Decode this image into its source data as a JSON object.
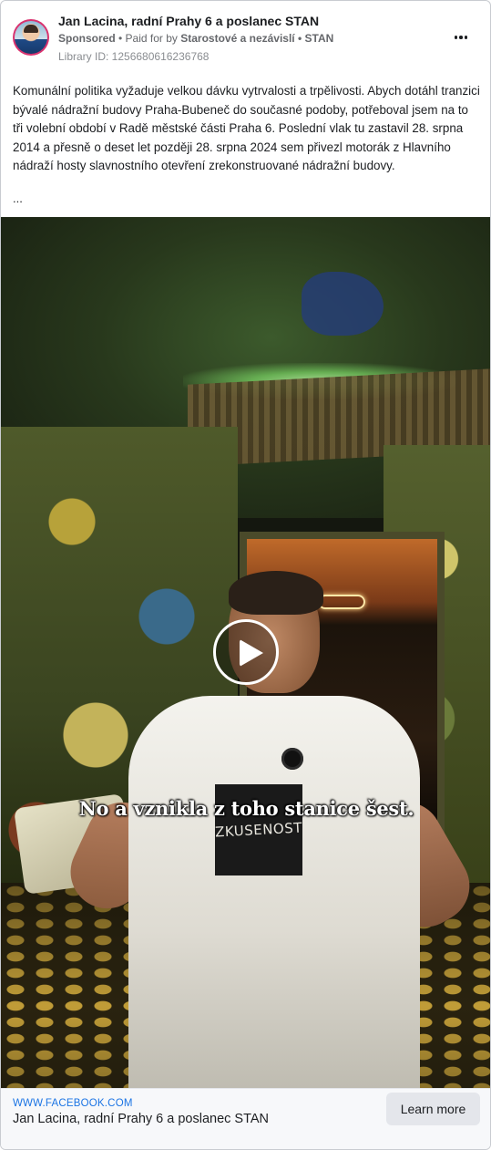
{
  "header": {
    "page_name": "Jan Lacina, radní Prahy 6 a poslanec STAN",
    "sponsored_label": "Sponsored",
    "separator": " • ",
    "paid_for_prefix": "Paid for by ",
    "payer": "Starostové a nezávislí • STAN",
    "library_id": "Library ID: 1256680616236768",
    "more_icon": "more-horizontal-icon"
  },
  "body": {
    "text": "Komunální politika vyžaduje velkou dávku vytrvalosti a trpělivosti. Abych dotáhl tranzici bývalé nádražní budovy Praha-Bubeneč do současné podoby, potřeboval jsem na to tři volební období v Radě městské části Praha 6. Poslední vlak tu zastavil 28. srpna 2014 a přesně o deset let později 28. srpna 2024 sem přivezl motorák z Hlavního nádraží hosty slavnostního otevření zrekonstruované nádražní budovy.",
    "ellipsis": "..."
  },
  "video": {
    "subtitle": "No a vznikla z toho stanice šest.",
    "shirt_text": "ZKUSENOST",
    "play_icon": "play-icon"
  },
  "footer": {
    "domain": "WWW.FACEBOOK.COM",
    "title": "Jan Lacina, radní Prahy 6 a poslanec STAN",
    "cta_label": "Learn more"
  },
  "colors": {
    "link_blue": "#1b74e4",
    "avatar_ring": "#d9336f",
    "button_gray": "#e4e6eb"
  }
}
